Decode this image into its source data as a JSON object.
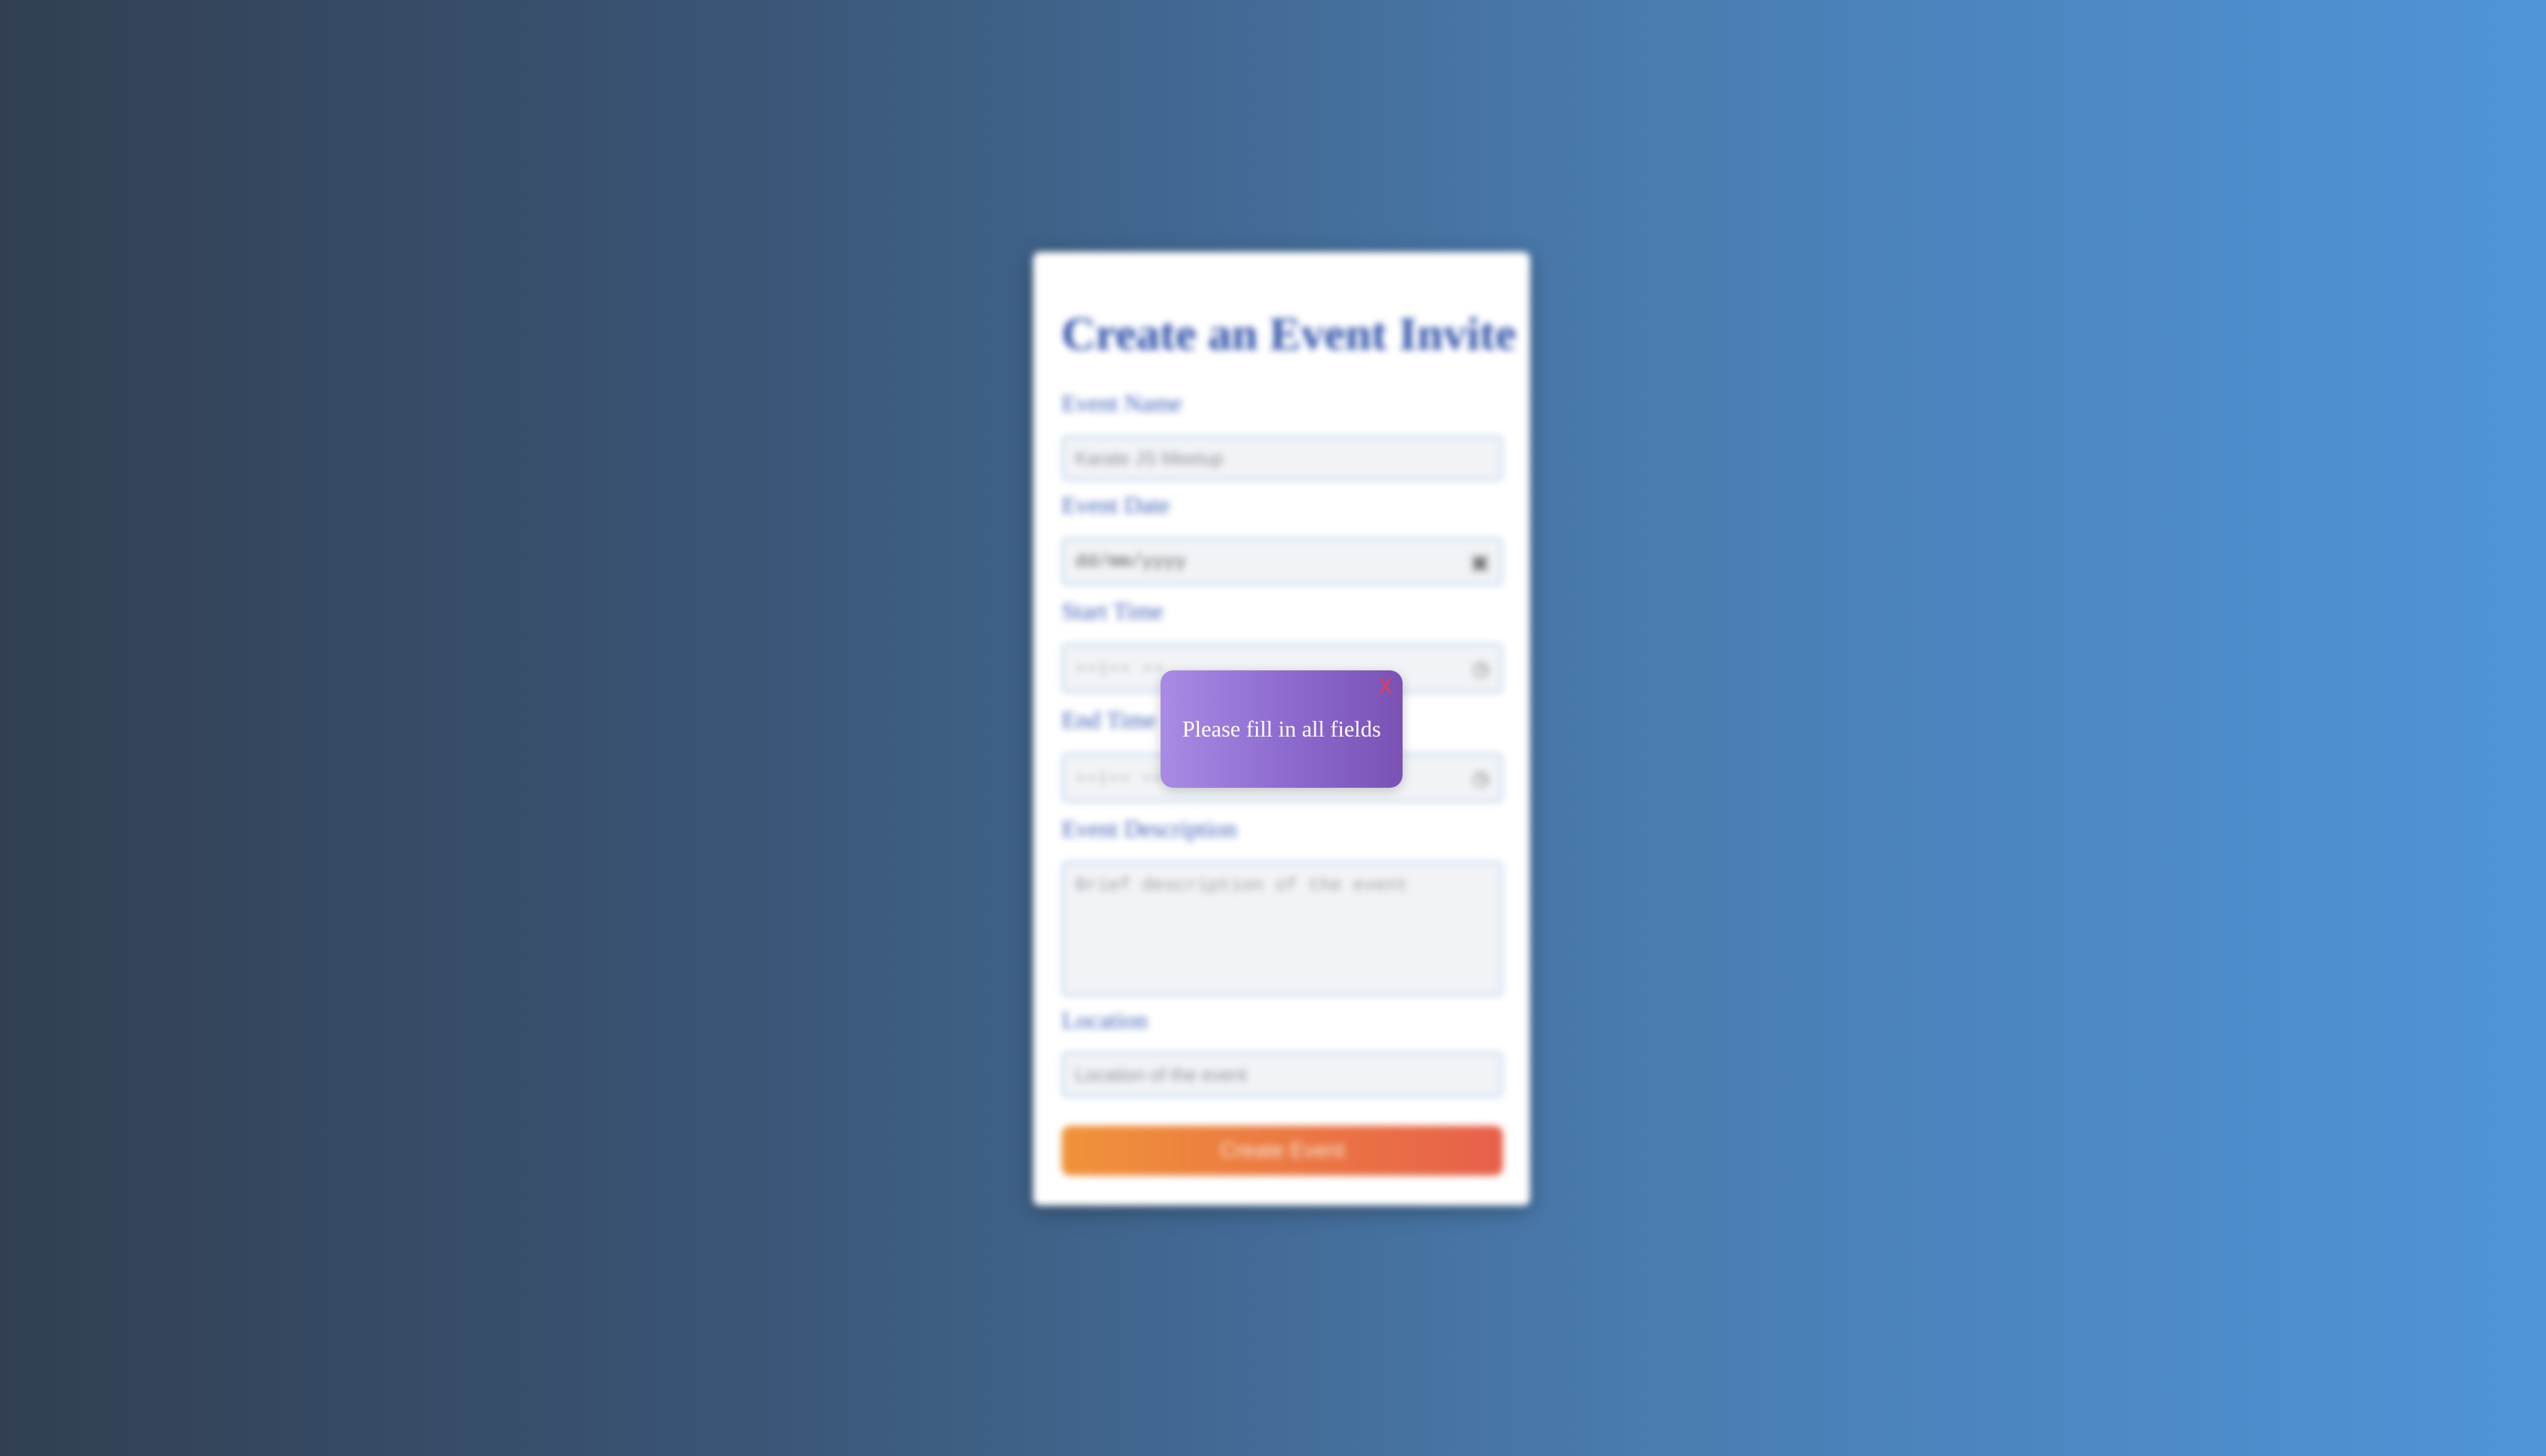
{
  "form": {
    "title": "Create an Event Invite",
    "fields": [
      {
        "label": "Event Name",
        "placeholder": "Karate JS Meetup"
      },
      {
        "label": "Event Date",
        "value": "dd/mm/yyyy",
        "icon": "calendar-icon"
      },
      {
        "label": "Start Time",
        "value": "--:-- --",
        "icon": "clock-icon"
      },
      {
        "label": "End Time",
        "value": "--:-- --",
        "icon": "clock-icon"
      },
      {
        "label": "Event Description",
        "placeholder": "Brief description of the event"
      },
      {
        "label": "Location",
        "placeholder": "Location of the event"
      }
    ],
    "submit_label": "Create Event"
  },
  "toast": {
    "message": "Please fill in all fields",
    "close_label": "X"
  },
  "colors": {
    "accent_title": "#2c4fa8",
    "button_start": "#f0923a",
    "button_end": "#e6604a",
    "toast_start": "#a88be4",
    "toast_end": "#7a52b4",
    "close_x": "#e23b63"
  }
}
